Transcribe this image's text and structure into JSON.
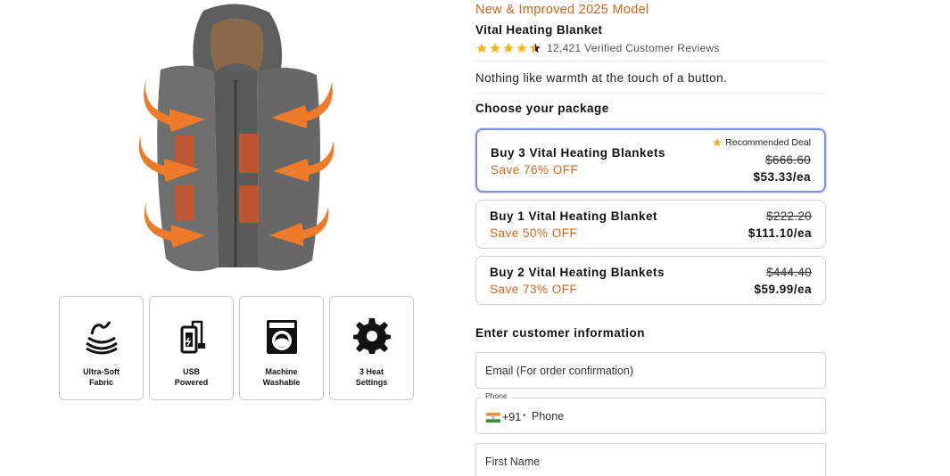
{
  "product": {
    "promo": "New & Improved 2025 Model",
    "title": "Vital Heating Blanket",
    "rating": 4.5,
    "reviews": "12,421 Verified Customer Reviews",
    "tagline": "Nothing like warmth at the touch of a button."
  },
  "features": [
    {
      "icon": "ultra-soft-fabric-icon",
      "label": "Ultra-Soft\nFabric"
    },
    {
      "icon": "usb-power-bank-icon",
      "label": "USB\nPowered"
    },
    {
      "icon": "washing-machine-icon",
      "label": "Machine\nWashable"
    },
    {
      "icon": "gear-icon",
      "label": "3 Heat\nSettings"
    }
  ],
  "package_section": {
    "heading": "Choose your package",
    "badge": "Recommended Deal",
    "options": [
      {
        "name": "Buy 3 Vital Heating Blankets",
        "save": "Save 76% OFF",
        "original": "$666.60",
        "price": "$53.33/ea",
        "selected": true
      },
      {
        "name": "Buy 1 Vital Heating Blanket",
        "save": "Save 50% OFF",
        "original": "$222.20",
        "price": "$111.10/ea",
        "selected": false
      },
      {
        "name": "Buy 2 Vital Heating Blankets",
        "save": "Save 73% OFF",
        "original": "$444.40",
        "price": "$59.99/ea",
        "selected": false
      }
    ]
  },
  "customer_section": {
    "heading": "Enter customer information",
    "email_placeholder": "Email (For order confirmation)",
    "phone_label": "Phone",
    "phone_code": "+91",
    "phone_placeholder": "Phone",
    "first_name_placeholder": "First Name"
  },
  "colors": {
    "accent_orange": "#d4631f",
    "selected_border": "#7c8ee6",
    "star": "#f3b51d"
  }
}
